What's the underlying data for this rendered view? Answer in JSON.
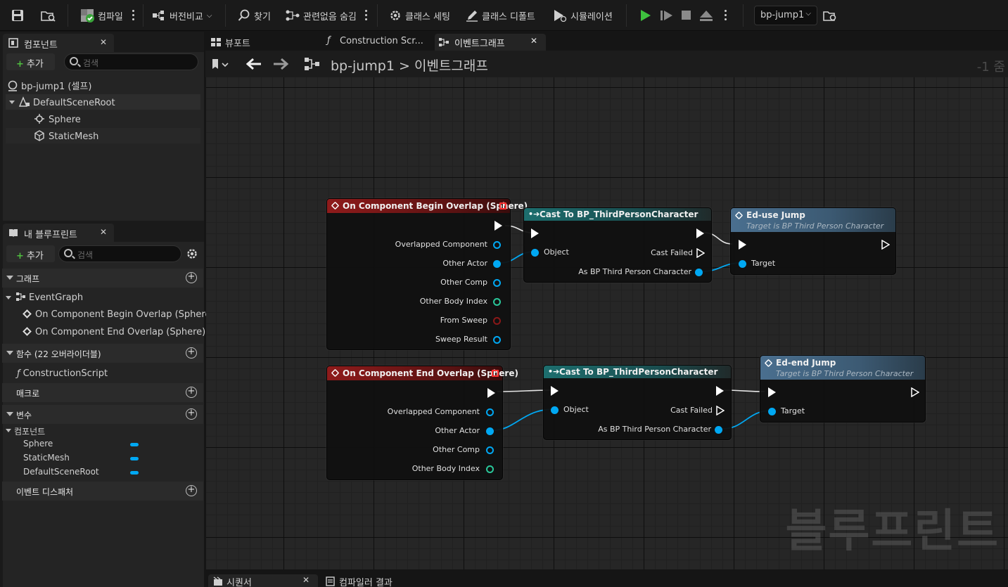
{
  "toolbar": {
    "compile": "컴파일",
    "version_compare": "버전비교",
    "find": "찾기",
    "hide_unrelated": "관련없음 숨김",
    "class_settings": "클래스 세팅",
    "class_defaults": "클래스 디폴트",
    "simulation": "시뮬레이션",
    "blueprint_select": "bp-jump1"
  },
  "components_panel": {
    "tab_label": "컴포넌트",
    "add_label": "추가",
    "search_placeholder": "검색",
    "items": [
      "bp-jump1 (셀프)",
      "DefaultSceneRoot",
      "Sphere",
      "StaticMesh"
    ]
  },
  "my_blueprint": {
    "tab_label": "내 블루프린트",
    "add_label": "추가",
    "search_placeholder": "검색",
    "graphs_header": "그래프",
    "event_graph": "EventGraph",
    "events": [
      "On Component Begin Overlap (Sphere)",
      "On Component End Overlap (Sphere)"
    ],
    "functions_header": "함수 (22 오버라이더블)",
    "construction_script": "ConstructionScript",
    "macros_header": "매크로",
    "variables_header": "변수",
    "components_group": "컴포넌트",
    "variables": [
      "Sphere",
      "StaticMesh",
      "DefaultSceneRoot"
    ],
    "event_dispatchers_header": "이벤트 디스패처"
  },
  "main_tabs": [
    "뷰포트",
    "Construction Scr...",
    "이벤트그래프"
  ],
  "breadcrumb": {
    "root": "bp-jump1",
    "sep": ">",
    "current": "이벤트그래프"
  },
  "zoom_label": "-1 줌",
  "watermark": "블루프린트",
  "nodes": {
    "begin_overlap": {
      "title": "On Component Begin Overlap (Sphere)",
      "pins": [
        "Overlapped Component",
        "Other Actor",
        "Other Comp",
        "Other Body Index",
        "From Sweep",
        "Sweep Result"
      ]
    },
    "cast1": {
      "title": "Cast To BP_ThirdPersonCharacter",
      "object": "Object",
      "cast_failed": "Cast Failed",
      "as_pin": "As BP Third Person Character"
    },
    "use_jump": {
      "title": "Ed-use Jump",
      "subtitle": "Target is BP Third Person Character",
      "target": "Target"
    },
    "end_overlap": {
      "title": "On Component End Overlap (Sphere)",
      "pins": [
        "Overlapped Component",
        "Other Actor",
        "Other Comp",
        "Other Body Index"
      ]
    },
    "cast2": {
      "title": "Cast To BP_ThirdPersonCharacter",
      "object": "Object",
      "cast_failed": "Cast Failed",
      "as_pin": "As BP Third Person Character"
    },
    "end_jump": {
      "title": "Ed-end Jump",
      "subtitle": "Target is BP Third Person Character",
      "target": "Target"
    }
  },
  "bottom_tabs": [
    "시퀀서",
    "컴파일러 결과"
  ]
}
